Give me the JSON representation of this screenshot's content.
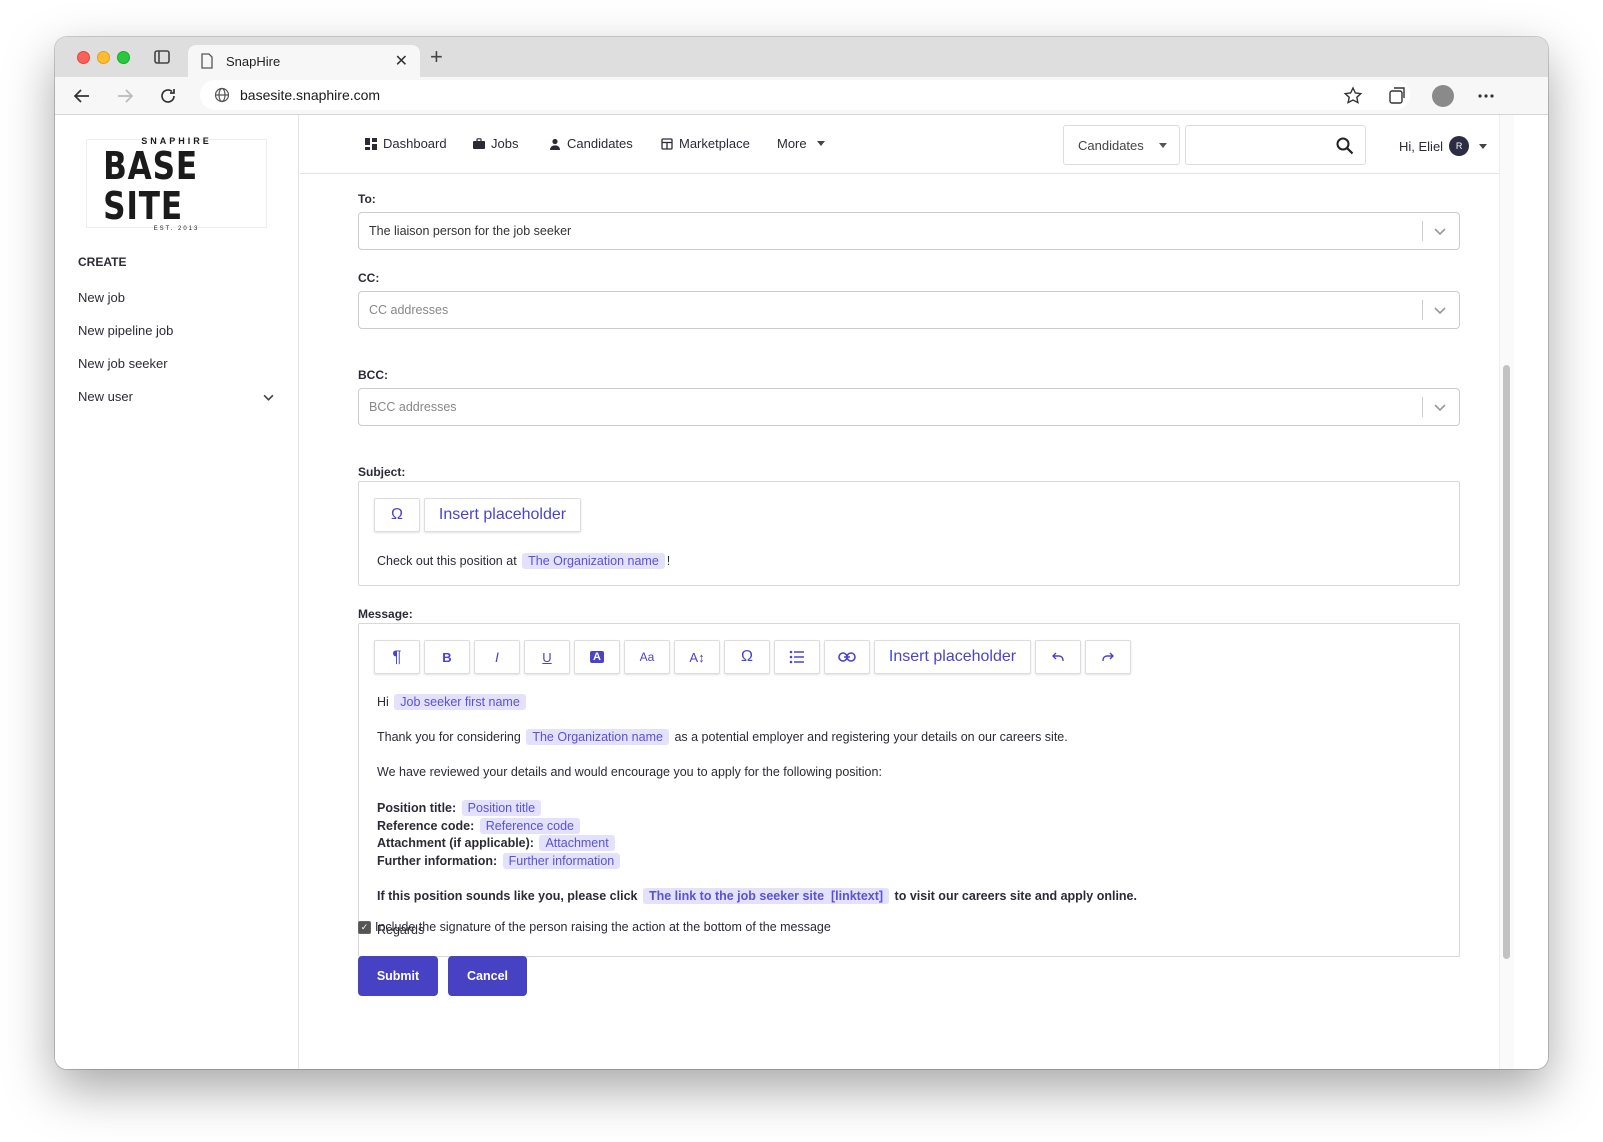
{
  "browser": {
    "tab_title": "SnapHire",
    "url": "basesite.snaphire.com"
  },
  "logo": {
    "top_text": "SNAPHIRE",
    "main_text": "BASE SITE",
    "est_text": "EST. 2013"
  },
  "sidebar": {
    "heading": "CREATE",
    "items": [
      {
        "label": "New job"
      },
      {
        "label": "New pipeline job"
      },
      {
        "label": "New job seeker"
      },
      {
        "label": "New user"
      }
    ]
  },
  "topnav": {
    "links": [
      {
        "label": "Dashboard",
        "icon": "dashboard-icon"
      },
      {
        "label": "Jobs",
        "icon": "briefcase-icon"
      },
      {
        "label": "Candidates",
        "icon": "person-icon"
      },
      {
        "label": "Marketplace",
        "icon": "store-icon"
      },
      {
        "label": "More",
        "icon": "caret-down-icon"
      }
    ],
    "search_scope": "Candidates",
    "search_value": "",
    "greeting": "Hi, Eliel",
    "avatar_initial": "R"
  },
  "form": {
    "to_label": "To:",
    "to_value": "The liaison person for the job seeker",
    "cc_label": "CC:",
    "cc_placeholder": "CC addresses",
    "bcc_label": "BCC:",
    "bcc_placeholder": "BCC addresses",
    "subject_label": "Subject:",
    "subject_toolbar": {
      "omega": "Ω",
      "insert_placeholder": "Insert placeholder"
    },
    "subject_text_before": "Check out this position at",
    "subject_chip": "The Organization name",
    "subject_text_after": "!",
    "message_label": "Message:",
    "message_toolbar": {
      "paragraph": "¶",
      "bold": "B",
      "italic": "I",
      "underline": "U",
      "text_color": "A",
      "font_size": "Aa",
      "line_height": "A↕",
      "omega": "Ω",
      "insert_placeholder": "Insert placeholder"
    },
    "message": {
      "greeting": "Hi",
      "greeting_chip": "Job seeker first name",
      "thanks_before": "Thank you for considering",
      "thanks_chip": "The Organization name",
      "thanks_after": "as a potential employer and registering your details on our careers site.",
      "reviewed": "We have reviewed your details and would encourage you to apply for the following position:",
      "position_title_label": "Position title:",
      "position_title_chip": "Position title",
      "reference_label": "Reference code:",
      "reference_chip": "Reference code",
      "attachment_label": "Attachment (if applicable):",
      "attachment_chip": "Attachment",
      "further_label": "Further information:",
      "further_chip": "Further information",
      "cta_before": "If this position sounds like you, please click",
      "cta_chip": "The link to the job seeker site  [linktext]",
      "cta_after": "to visit our careers site and apply online.",
      "regards": "Regards"
    },
    "signature_checkbox": {
      "label": "Include the signature of the person raising the action at the bottom of the message",
      "checked": true
    },
    "submit_label": "Submit",
    "cancel_label": "Cancel"
  }
}
